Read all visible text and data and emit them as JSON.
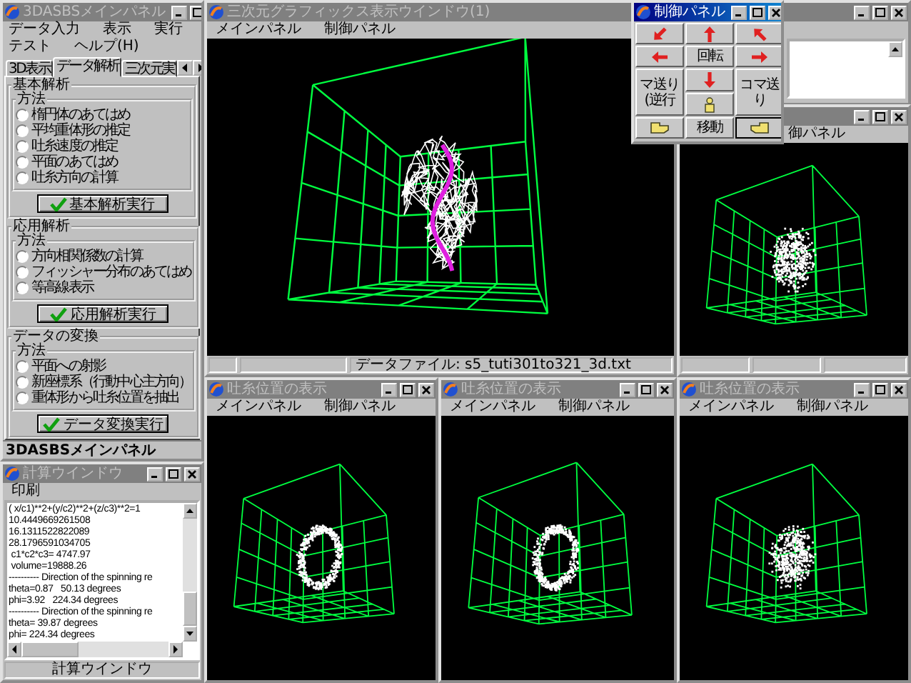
{
  "main_panel": {
    "title": "3DASBSメインパネル",
    "active": false,
    "menu_rows": [
      [
        "データ入力",
        "表示",
        "実行"
      ],
      [
        "テスト",
        "ヘルプ(H)"
      ]
    ],
    "tabs": [
      {
        "label": "3D表示",
        "selected": false
      },
      {
        "label": "データ解析",
        "selected": true
      },
      {
        "label": "三次元実",
        "selected": false
      }
    ],
    "groups": [
      {
        "title": "基本解析",
        "method_title": "方法",
        "options": [
          {
            "label": "楕円体のあてはめ",
            "selected": false
          },
          {
            "label": "平均重体形の推定",
            "selected": false
          },
          {
            "label": "吐糸速度の推定",
            "selected": false
          },
          {
            "label": "平面のあてはめ",
            "selected": false
          },
          {
            "label": "吐糸方向の計算",
            "selected": false
          }
        ],
        "button": "基本解析実行"
      },
      {
        "title": "応用解析",
        "method_title": "方法",
        "options": [
          {
            "label": "方向相関係数の計算",
            "selected": false
          },
          {
            "label": "フィッシャー分布のあてはめ",
            "selected": false
          },
          {
            "label": "等高線表示",
            "selected": false
          }
        ],
        "button": "応用解析実行"
      },
      {
        "title": "データの変換",
        "method_title": "方法",
        "options": [
          {
            "label": "平面への射影",
            "selected": false
          },
          {
            "label": "新座標系（行動中心主方向）",
            "selected": false
          },
          {
            "label": "重体形から吐糸位置を抽出",
            "selected": false
          }
        ],
        "button": "データ変換実行"
      }
    ],
    "status": "3DASBSメインパネル"
  },
  "calc_window": {
    "title": "計算ウインドウ",
    "active": false,
    "menu": [
      "印刷"
    ],
    "lines": [
      "( x/c1)**2+(y/c2)**2+(z/c3)**2=1",
      "10.4449669261508",
      "16.1311522822089",
      "28.1796591034705",
      " c1*c2*c3= 4747.97",
      " volume=19888.26",
      "---------- Direction of the spinning re",
      "theta=0.87   50.13 degrees",
      "phi=3.92   224.34 degrees",
      "---------- Direction of the spinning re",
      "theta= 39.87 degrees",
      "phi= 224.34 degrees"
    ],
    "status": "計算ウインドウ"
  },
  "plot_windows": [
    {
      "title": "三次元グラフィックス表示ウインドウ(1)",
      "active": false,
      "menu": [
        "メインパネル",
        "制御パネル"
      ],
      "kind": "trajectory",
      "status": "データファイル: s5_tuti301to321_3d.txt"
    },
    {
      "active": false,
      "menu": [
        "御パネル"
      ],
      "kind": "cloud"
    },
    {
      "title": "吐糸位置の表示",
      "active": false,
      "menu": [
        "メインパネル",
        "制御パネル"
      ],
      "kind": "ring"
    },
    {
      "title": "吐糸位置の表示",
      "active": false,
      "menu": [
        "メインパネル",
        "制御パネル"
      ],
      "kind": "ring"
    },
    {
      "title": "吐糸位置の表示",
      "active": false,
      "menu": [
        "メインパネル",
        "制御パネル"
      ],
      "kind": "cloud"
    }
  ],
  "control_panel": {
    "title": "制御パネル",
    "active": true,
    "rotate": "回転",
    "move": "移動",
    "frame_back": "マ送り(逆行",
    "frame_forward": "コマ送り"
  }
}
